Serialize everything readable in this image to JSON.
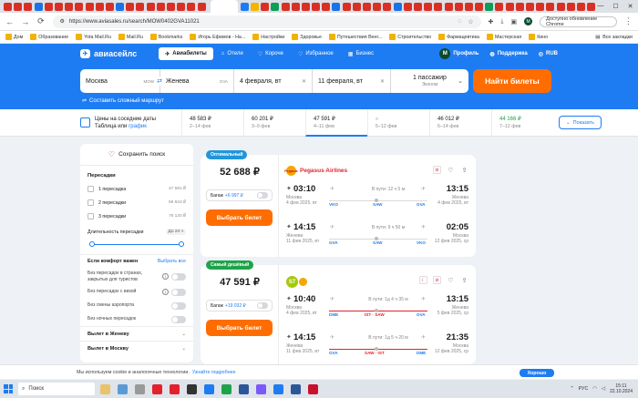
{
  "browser": {
    "url": "https://www.aviasales.ru/search/MOW0402GVA11021",
    "update_button": "Доступно обновление Chrome",
    "bookmarks": [
      "Дом",
      "Образование",
      "Yota Mail.Ru",
      "Mail.Ru",
      "Bookmarks",
      "Игорь Ефимов - На...",
      "Настройки",
      "Здоровье",
      "Путешествия Венг...",
      "Строительство",
      "Фармацевтика",
      "Мастерская",
      "Кино"
    ],
    "all_bookmarks": "Все закладки"
  },
  "header": {
    "logo": "авиасейлс",
    "tabs": [
      "Авиабилеты",
      "Отели",
      "Короче",
      "Избранное",
      "Бизнес"
    ],
    "profile": "Профиль",
    "profile_initial": "M",
    "support": "Поддержка",
    "currency": "RUB"
  },
  "search": {
    "from": "Москва",
    "from_code": "MOW",
    "to": "Женева",
    "to_code": "GVA",
    "depart_date": "4 февраля, вт",
    "return_date": "11 февраля, вт",
    "passengers": "1 пассажир",
    "cabin": "Эконом",
    "button": "Найти билеты",
    "complex_route": "Составить сложный маршрут"
  },
  "calendar": {
    "title": "Цены на соседние даты",
    "subtitle_prefix": "Таблица или",
    "subtitle_link": "график",
    "cells": [
      {
        "price": "48 583 ₽",
        "dates": "2–14 фев"
      },
      {
        "price": "60 201 ₽",
        "dates": "3–9 фев"
      },
      {
        "price": "47 591 ₽",
        "dates": "4–11 фев"
      },
      {
        "price": "",
        "dates": "5–12 фев"
      },
      {
        "price": "46 012 ₽",
        "dates": "6–14 фев"
      },
      {
        "price": "44 166 ₽",
        "dates": "7–12 фев"
      }
    ],
    "show_button": "Показать"
  },
  "filters": {
    "save_search": "Сохранить поиск",
    "transfers_title": "Пересадки",
    "transfers": [
      {
        "label": "1 пересадка",
        "price": "47 591 ₽"
      },
      {
        "label": "2 пересадки",
        "price": "59 843 ₽"
      },
      {
        "label": "3 пересадки",
        "price": "76 120 ₽"
      }
    ],
    "duration_label": "Длительность пересадки",
    "duration_value": "До 24 ч",
    "comfort_title": "Если комфорт важен",
    "select_all": "Выбрать все",
    "toggles": [
      "Без пересадок в странах, закрытых для туристов",
      "Без пересадок с визой",
      "Без смены аэропорта",
      "Без ночных пересадок"
    ],
    "departure_geneva": "Вылет в Женеву",
    "departure_moscow": "Вылет в Москву"
  },
  "tickets": [
    {
      "badge": "Оптимальный",
      "badge_color": "#2196d9",
      "price": "52 688 ₽",
      "baggage_label": "Багаж",
      "baggage_extra": "+6 997 ₽",
      "buy": "Выбрать билет",
      "airline": "Pegasus Airlines",
      "segments": [
        {
          "dep_time": "03:10",
          "arr_time": "13:15",
          "dep_city": "Москва",
          "dep_date": "4 фев 2025, вт",
          "arr_city": "Женева",
          "arr_date": "4 фев 2025, вт",
          "duration": "В пути: 12 ч 5 м",
          "codes": [
            "VKO",
            "SAW",
            "GVA"
          ]
        },
        {
          "dep_time": "14:15",
          "arr_time": "02:05",
          "dep_city": "Женева",
          "dep_date": "11 фев 2025, вт",
          "arr_city": "Москва",
          "arr_date": "12 фев 2025, ср",
          "duration": "В пути: 9 ч 50 м",
          "codes": [
            "GVA",
            "SAW",
            "VKO"
          ]
        }
      ]
    },
    {
      "badge": "Самый дешёвый",
      "badge_color": "#1fa34a",
      "price": "47 591 ₽",
      "baggage_label": "Багаж",
      "baggage_extra": "+19 032 ₽",
      "buy": "Выбрать билет",
      "airline": "",
      "segments": [
        {
          "dep_time": "10:40",
          "arr_time": "13:15",
          "dep_city": "Москва",
          "dep_date": "4 фев 2025, вт",
          "arr_city": "Женева",
          "arr_date": "5 фев 2025, ср",
          "duration": "В пути: 1д 4 ч 35 м",
          "codes": [
            "DME",
            "IST · SAW",
            "GVA"
          ]
        },
        {
          "dep_time": "14:15",
          "arr_time": "21:35",
          "dep_city": "Женева",
          "dep_date": "11 фев 2025, вт",
          "arr_city": "Москва",
          "arr_date": "12 фев 2025, ср",
          "duration": "В пути: 1д 5 ч 20 м",
          "codes": [
            "GVA",
            "SAW · IST",
            "DME"
          ]
        }
      ]
    }
  ],
  "cookie": {
    "text": "Мы используем cookie и аналогичные технологии.",
    "link": "Узнайте подробнее",
    "button": "Хорошо"
  },
  "taskbar": {
    "search": "Поиск",
    "lang": "РУС",
    "time": "15:11",
    "date": "22.10.2024"
  }
}
